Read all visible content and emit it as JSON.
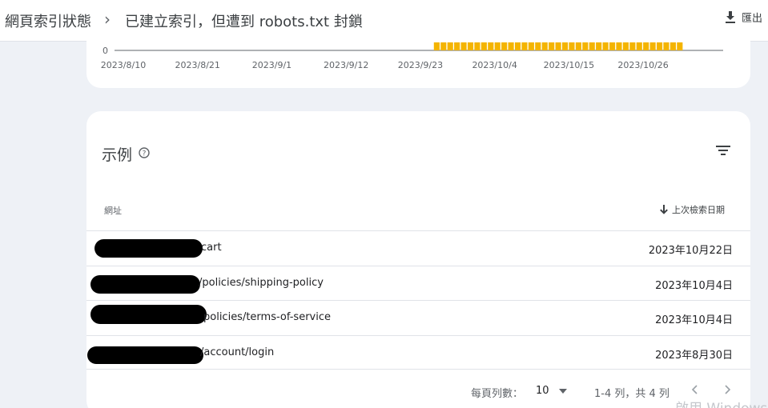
{
  "header": {
    "breadcrumb_root": "網頁索引狀態",
    "breadcrumb_separator": "›",
    "breadcrumb_current": "已建立索引，但遭到 robots.txt 封鎖",
    "export_label": "匯出"
  },
  "chart_data": {
    "type": "bar",
    "y_tick_zero": "0",
    "x_tick_labels": [
      "2023/8/10",
      "2023/8/21",
      "2023/9/1",
      "2023/9/12",
      "2023/9/23",
      "2023/10/4",
      "2023/10/15",
      "2023/10/26"
    ],
    "bar_color": "#f4b400",
    "bars_start": "2023/9/25",
    "bars_end": "2023/10/31"
  },
  "examples": {
    "title": "示例",
    "col_url": "網址",
    "col_date": "上次檢索日期",
    "rows": [
      {
        "url": "cart",
        "date": "2023年10月22日"
      },
      {
        "url": "/policies/shipping-policy",
        "date": "2023年10月4日"
      },
      {
        "url": "policies/terms-of-service",
        "date": "2023年10月4日"
      },
      {
        "url": "/account/login",
        "date": "2023年8月30日"
      }
    ],
    "pager": {
      "rows_per_page_label": "每頁列數：",
      "rows_per_page_value": "10",
      "range": "1-4 列，共 4 列"
    }
  },
  "watermark": "啟用 Windows"
}
